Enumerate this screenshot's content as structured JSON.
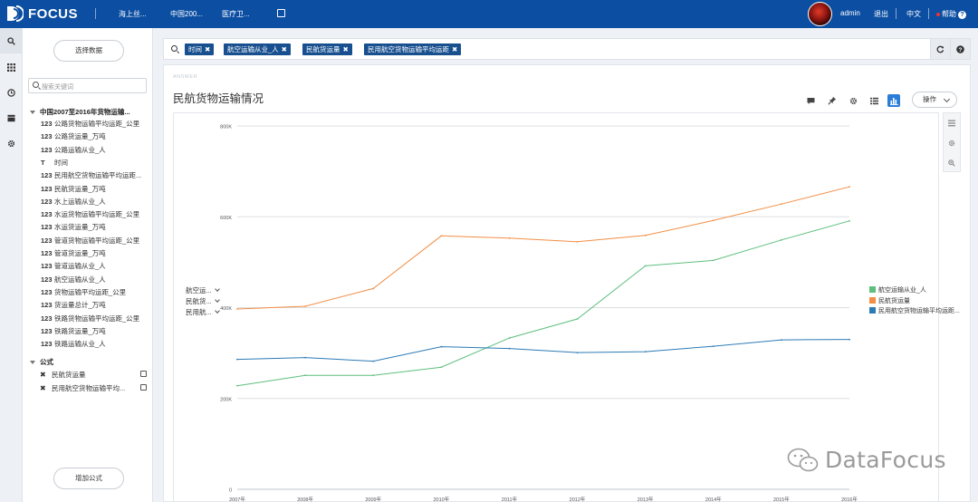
{
  "app": {
    "brand": "FOCUS",
    "tabs": [
      "海上丝...",
      "中国200...",
      "医疗卫..."
    ],
    "user": "admin",
    "logout": "退出",
    "language": "中文",
    "help": "帮助"
  },
  "datapanel": {
    "select_data_button": "选择数据",
    "search_placeholder": "搜索关键词",
    "table_name": "中国2007至2016年货物运输...",
    "columns": [
      {
        "type": "123",
        "name": "公路货物运输平均运距_公里"
      },
      {
        "type": "123",
        "name": "公路货运量_万吨"
      },
      {
        "type": "123",
        "name": "公路运输从业_人"
      },
      {
        "type": "T",
        "name": "时间"
      },
      {
        "type": "123",
        "name": "民用航空货物运输平均运距..."
      },
      {
        "type": "123",
        "name": "民航货运量_万吨"
      },
      {
        "type": "123",
        "name": "水上运输从业_人"
      },
      {
        "type": "123",
        "name": "水运货物运输平均运距_公里"
      },
      {
        "type": "123",
        "name": "水运货运量_万吨"
      },
      {
        "type": "123",
        "name": "管道货物运输平均运距_公里"
      },
      {
        "type": "123",
        "name": "管道货运量_万吨"
      },
      {
        "type": "123",
        "name": "管道运输从业_人"
      },
      {
        "type": "123",
        "name": "航空运输从业_人"
      },
      {
        "type": "123",
        "name": "货物运输平均运距_公里"
      },
      {
        "type": "123",
        "name": "货运量总计_万吨"
      },
      {
        "type": "123",
        "name": "铁路货物运输平均运距_公里"
      },
      {
        "type": "123",
        "name": "铁路货运量_万吨"
      },
      {
        "type": "123",
        "name": "铁路运输从业_人"
      }
    ],
    "formula_header": "公式",
    "formulas": [
      "民航货运量",
      "民用航空货物运输平均..."
    ],
    "add_formula_button": "增加公式"
  },
  "search": {
    "chips": [
      "时间",
      "航空运输从业_人",
      "民航货运量",
      "民用航空货物运输平均运距"
    ]
  },
  "answer": {
    "label": "ANSWER",
    "title": "民航货物运输情况",
    "operate_button": "操作",
    "measure_selectors": [
      "航空运...",
      "民航货...",
      "民用航..."
    ]
  },
  "colors": {
    "accent": "#0b4ea2",
    "chip": "#174f8f",
    "series_green": "#5fbf7e",
    "series_orange": "#f28e45",
    "series_blue": "#2c7bb6"
  },
  "chart_data": {
    "type": "line",
    "x": [
      "2007年",
      "2008年",
      "2009年",
      "2010年",
      "2011年",
      "2012年",
      "2013年",
      "2014年",
      "2015年",
      "2016年"
    ],
    "ylim": [
      0,
      800000
    ],
    "yticks": [
      "0",
      "200K",
      "400K",
      "600K",
      "800K"
    ],
    "ytick_values": [
      0,
      200000,
      400000,
      600000,
      800000
    ],
    "grid": true,
    "legend_position": "right",
    "series": [
      {
        "name": "航空运输从业_人",
        "color": "#5fbf7e",
        "values": [
          228000,
          251000,
          251000,
          269000,
          333000,
          375000,
          492000,
          504000,
          549000,
          591000
        ]
      },
      {
        "name": "民航货运量",
        "color": "#f28e45",
        "values": [
          397000,
          403000,
          442000,
          558000,
          553000,
          545000,
          559000,
          592000,
          628000,
          666000
        ]
      },
      {
        "name": "民用航空货物运输平均运距...",
        "color": "#2c7bb6",
        "values": [
          286000,
          290000,
          282000,
          314000,
          310000,
          301000,
          303000,
          315000,
          329000,
          330000
        ]
      }
    ]
  },
  "watermark": "DataFocus"
}
